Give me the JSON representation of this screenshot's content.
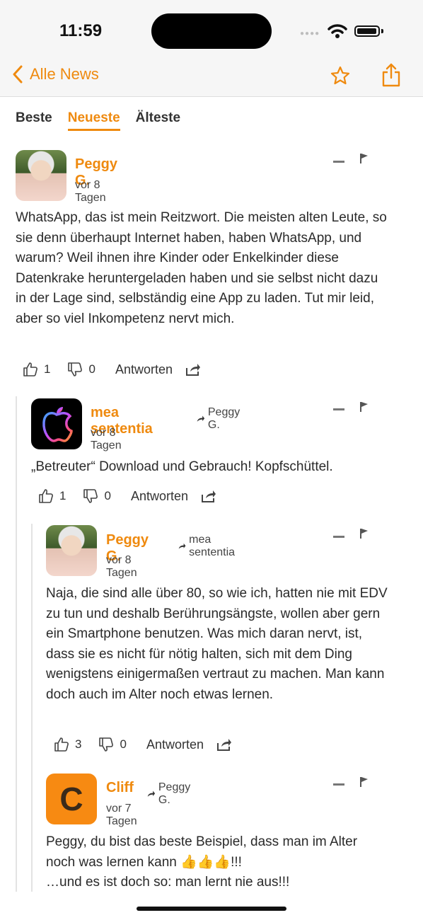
{
  "status": {
    "time": "11:59"
  },
  "nav": {
    "back_label": "Alle News",
    "back_icon": "chevron-left-icon",
    "favorite_icon": "star-icon",
    "share_icon": "share-icon"
  },
  "tabs": [
    {
      "label": "Beste",
      "active": false
    },
    {
      "label": "Neueste",
      "active": true
    },
    {
      "label": "Älteste",
      "active": false
    }
  ],
  "accent_color": "#ef8a0f",
  "comments": [
    {
      "author": "Peggy G.",
      "time": "vor 8 Tagen",
      "reply_to": "",
      "text": "WhatsApp, das ist mein Reitzwort. Die meisten alten Leute, so sie denn überhaupt Internet haben, haben WhatsApp, und warum? Weil ihnen ihre Kinder oder Enkelkinder diese Datenkrake heruntergeladen haben und sie selbst nicht dazu in der Lage sind, selbständig eine App zu laden. Tut mir leid, aber so viel Inkompetenz nervt mich.",
      "likes": "1",
      "dislikes": "0",
      "reply_label": "Antworten"
    },
    {
      "author": "mea sententia",
      "time": "vor 8 Tagen",
      "reply_to": "Peggy G.",
      "text": "„Betreuter“ Download und Gebrauch! Kopfschüttel.",
      "likes": "1",
      "dislikes": "0",
      "reply_label": "Antworten"
    },
    {
      "author": "Peggy G.",
      "time": "vor 8 Tagen",
      "reply_to": "mea sententia",
      "text": "Naja, die sind alle über 80, so wie ich, hatten nie mit EDV zu tun und deshalb Berührungsängste, wollen aber gern ein Smartphone benutzen. Was mich daran nervt, ist, dass sie es nicht für nötig halten, sich mit dem Ding wenigstens einigermaßen vertraut zu machen. Man kann doch auch im Alter noch etwas lernen.",
      "likes": "3",
      "dislikes": "0",
      "reply_label": "Antworten"
    },
    {
      "author": "Cliff",
      "avatar_letter": "C",
      "time": "vor 7 Tagen",
      "reply_to": "Peggy G.",
      "text_line1": "Peggy, du bist das beste Beispiel, dass man im Alter",
      "text_line2": "noch was lernen kann 👍👍👍!!!",
      "text_line3": "…und es ist doch so: man lernt nie aus!!!"
    }
  ]
}
